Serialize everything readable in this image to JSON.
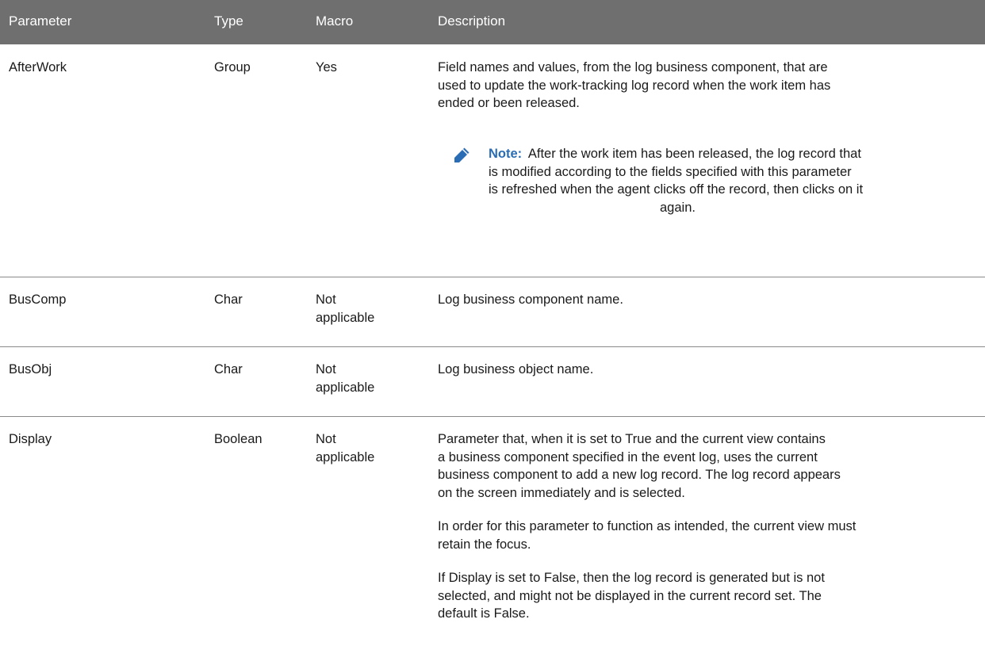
{
  "header": {
    "parameter": "Parameter",
    "type": "Type",
    "macro": "Macro",
    "description": "Description"
  },
  "rows": [
    {
      "parameter": "AfterWork",
      "type": "Group",
      "macro": "Yes",
      "description_lines": [
        "Field names and values, from the log business component, that are",
        "used to update the work-tracking log record when the work item has",
        "ended or been released."
      ],
      "note": {
        "icon": "pencil-icon",
        "label": "Note:",
        "lines": [
          "After the work item has been released, the log record that",
          "is modified according to the fields specified with this parameter",
          "is refreshed when the agent clicks off the record, then clicks on it",
          "again."
        ]
      }
    },
    {
      "parameter": "BusComp",
      "type": "Char",
      "macro_lines": [
        "Not",
        "applicable"
      ],
      "description_lines": [
        "Log business component name."
      ]
    },
    {
      "parameter": "BusObj",
      "type": "Char",
      "macro_lines": [
        "Not",
        "applicable"
      ],
      "description_lines": [
        "Log business object name."
      ]
    },
    {
      "parameter": "Display",
      "type": "Boolean",
      "macro_lines": [
        "Not",
        "applicable"
      ],
      "paragraphs": [
        [
          "Parameter that, when it is set to True and the current view contains",
          "a business component specified in the event log, uses the current",
          "business component to add a new log record. The log record appears",
          "on the screen immediately and is selected."
        ],
        [
          "In order for this parameter to function as intended, the current view must",
          "retain the focus."
        ],
        [
          "If Display is set to False, then the log record is generated but is not",
          "selected, and might not be displayed in the current record set. The",
          "default is False."
        ]
      ]
    }
  ],
  "colors": {
    "header_bg": "#6f6f6f",
    "header_text": "#ffffff",
    "note_label": "#2a6db5",
    "pencil": "#2a6db5",
    "divider": "#8a8a8a"
  }
}
